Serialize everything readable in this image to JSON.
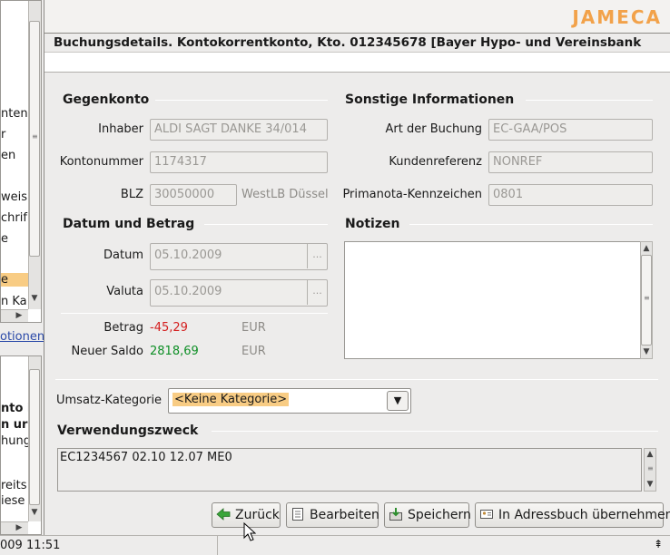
{
  "app": {
    "logo": "JAMECA"
  },
  "left_panel": {
    "top_lines": [
      "nten",
      "r",
      "en",
      "weis",
      "chrif",
      "e",
      "e",
      "n Ka"
    ],
    "link": "otionen",
    "bottom_lines": [
      "nto i",
      "n ur",
      "hung",
      "reits",
      "iese"
    ]
  },
  "window": {
    "title": "Buchungsdetails. Kontokorrentkonto, Kto. 012345678 [Bayer Hypo- und Vereinsbank"
  },
  "gegenkonto": {
    "heading": "Gegenkonto",
    "inhaber_label": "Inhaber",
    "inhaber_value": "ALDI SAGT DANKE 34/014",
    "kontonummer_label": "Kontonummer",
    "kontonummer_value": "1174317",
    "blz_label": "BLZ",
    "blz_value": "30050000",
    "bank_name": "WestLB Düssel"
  },
  "sonstige": {
    "heading": "Sonstige Informationen",
    "art_label": "Art der Buchung",
    "art_value": "EC-GAA/POS",
    "kundenref_label": "Kundenreferenz",
    "kundenref_value": "NONREF",
    "primanota_label": "Primanota-Kennzeichen",
    "primanota_value": "0801"
  },
  "datum_betrag": {
    "heading": "Datum und Betrag",
    "datum_label": "Datum",
    "datum_value": "05.10.2009",
    "valuta_label": "Valuta",
    "valuta_value": "05.10.2009",
    "picker_label": "...",
    "betrag_label": "Betrag",
    "betrag_value": "-45,29",
    "betrag_currency": "EUR",
    "saldo_label": "Neuer Saldo",
    "saldo_value": "2818,69",
    "saldo_currency": "EUR"
  },
  "notizen": {
    "heading": "Notizen",
    "value": ""
  },
  "kategorie": {
    "label": "Umsatz-Kategorie",
    "value": "<Keine Kategorie>"
  },
  "verwendungszweck": {
    "heading": "Verwendungszweck",
    "value": "EC1234567 02.10 12.07 ME0"
  },
  "buttons": {
    "zurueck": "Zurück",
    "bearbeiten": "Bearbeiten",
    "speichern": "Speichern",
    "adressbuch": "In Adressbuch übernehmen"
  },
  "statusbar": {
    "datetime": "009 11:51"
  },
  "colors": {
    "negative": "#d41f1f",
    "positive": "#0e8f26",
    "highlight": "#f8cc84",
    "logo": "#f2a24a"
  }
}
